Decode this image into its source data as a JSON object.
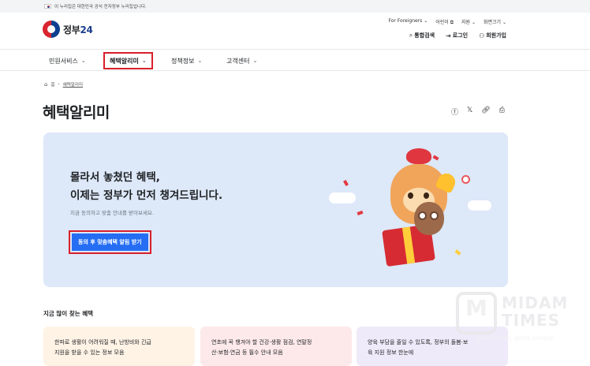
{
  "notice": {
    "text": "이 누리집은 대한민국 공식 전자정부 누리집입니다."
  },
  "header": {
    "logo_text": "정부",
    "logo_num": "24",
    "util_links": [
      "For Foreigners",
      "어린이",
      "지원",
      "화면크기"
    ],
    "search_label": "통합검색",
    "login_label": "로그인",
    "signup_label": "회원가입"
  },
  "gnb": {
    "items": [
      {
        "label": "민원서비스"
      },
      {
        "label": "혜택알리미"
      },
      {
        "label": "정책정보"
      },
      {
        "label": "고객센터"
      }
    ]
  },
  "breadcrumb": {
    "home_label": "홈",
    "current": "혜택알리미"
  },
  "page": {
    "title": "혜택알리미"
  },
  "hero": {
    "headline_1": "몰라서 놓쳤던 혜택,",
    "headline_2": "이제는 정부가 먼저 챙겨드립니다.",
    "subtext": "지금 동의하고 맞춤 안내를 받아보세요.",
    "cta_label": "동의 후 맞춤혜택 알림 받기"
  },
  "section": {
    "title": "지금 많이 찾는 혜택",
    "cards": [
      {
        "line1": "한파로 생활이 어려워질 때, 난방비와 긴급",
        "line2": "지원을 받을 수 있는 정보 모음"
      },
      {
        "line1": "연초에 꼭 챙겨야 할 건강·생활 점검, 연말정",
        "line2": "산·보험·연금 등 필수 안내 모음"
      },
      {
        "line1": "양육 부담을 줄일 수 있도록, 정부의 돌봄·보",
        "line2": "육 지원 정보 한눈에"
      }
    ]
  },
  "watermark": {
    "mark": "M",
    "line1": "MIDAM",
    "line2": "TIMES",
    "tagline": "good news, good people"
  },
  "colors": {
    "primary": "#256ef4",
    "highlight_border": "#d81f2a",
    "hero_bg": "#dde8f8"
  }
}
